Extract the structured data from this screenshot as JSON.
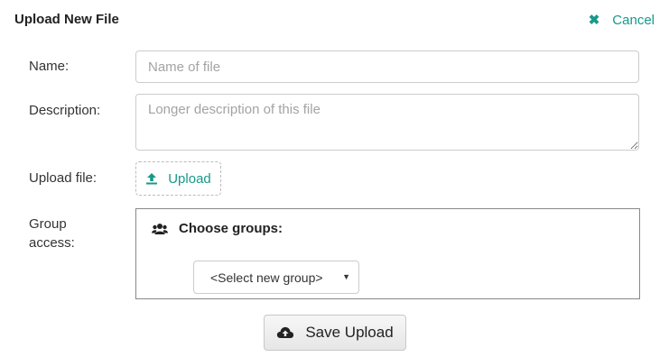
{
  "header": {
    "title": "Upload New File",
    "cancel_label": "Cancel",
    "cancel_icon": "close-icon"
  },
  "form": {
    "name": {
      "label": "Name:",
      "placeholder": "Name of file",
      "value": ""
    },
    "description": {
      "label": "Description:",
      "placeholder": "Longer description of this file",
      "value": ""
    },
    "upload": {
      "label": "Upload file:",
      "button_label": "Upload",
      "icon": "upload-icon"
    },
    "group_access": {
      "label": "Group access:",
      "header": "Choose groups:",
      "icon": "users-icon",
      "select_value": "<Select new group>"
    },
    "save": {
      "label": "Save Upload",
      "icon": "cloud-upload-icon"
    }
  },
  "colors": {
    "accent": "#17998a",
    "border": "#cccccc"
  }
}
